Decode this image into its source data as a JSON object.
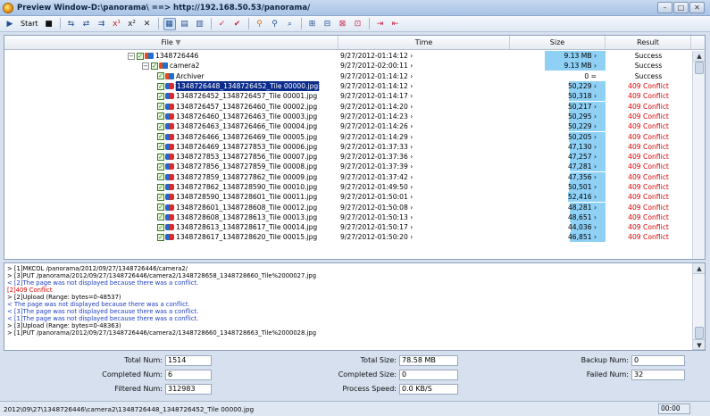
{
  "window": {
    "title": "Preview Window-D:\\panorama\\ ==> http://192.168.50.53/panorama/"
  },
  "toolbar": {
    "start_label": "Start"
  },
  "grid": {
    "columns": [
      "File",
      "Time",
      "Size",
      "Result"
    ],
    "rows": [
      {
        "indent": 0,
        "type": "root",
        "name": "1348726446",
        "time": "9/27/2012-01:14:12",
        "size": "9.13 MB",
        "result": "Success",
        "status": "ok",
        "fill": 0.45
      },
      {
        "indent": 1,
        "type": "folder",
        "name": "camera2",
        "time": "9/27/2012-02:00:11",
        "size": "9.13 MB",
        "result": "Success",
        "status": "ok",
        "fill": 0.45
      },
      {
        "indent": 2,
        "type": "folder",
        "name": "Archiver",
        "time": "9/27/2012-01:14:12",
        "size": "0",
        "result": "Success",
        "status": "ok",
        "fill": 0
      },
      {
        "indent": 2,
        "type": "file",
        "name": "1348726448_1348726452_Tile 00000.jpg",
        "time": "9/27/2012-01:14:12",
        "size": "50,229",
        "result": "409 Conflict",
        "status": "fail",
        "fill": 0.2,
        "selected": true
      },
      {
        "indent": 2,
        "type": "file",
        "name": "1348726452_1348726457_Tile 00001.jpg",
        "time": "9/27/2012-01:14:17",
        "size": "50,318",
        "result": "409 Conflict",
        "status": "fail",
        "fill": 0.2
      },
      {
        "indent": 2,
        "type": "file",
        "name": "1348726457_1348726460_Tile 00002.jpg",
        "time": "9/27/2012-01:14:20",
        "size": "50,217",
        "result": "409 Conflict",
        "status": "fail",
        "fill": 0.2
      },
      {
        "indent": 2,
        "type": "file",
        "name": "1348726460_1348726463_Tile 00003.jpg",
        "time": "9/27/2012-01:14:23",
        "size": "50,295",
        "result": "409 Conflict",
        "status": "fail",
        "fill": 0.2
      },
      {
        "indent": 2,
        "type": "file",
        "name": "1348726463_1348726466_Tile 00004.jpg",
        "time": "9/27/2012-01:14:26",
        "size": "50,229",
        "result": "409 Conflict",
        "status": "fail",
        "fill": 0.2
      },
      {
        "indent": 2,
        "type": "file",
        "name": "1348726466_1348726469_Tile 00005.jpg",
        "time": "9/27/2012-01:14:29",
        "size": "50,205",
        "result": "409 Conflict",
        "status": "fail",
        "fill": 0.2
      },
      {
        "indent": 2,
        "type": "file",
        "name": "1348726469_1348727853_Tile 00006.jpg",
        "time": "9/27/2012-01:37:33",
        "size": "47,130",
        "result": "409 Conflict",
        "status": "fail",
        "fill": 0.19
      },
      {
        "indent": 2,
        "type": "file",
        "name": "1348727853_1348727856_Tile 00007.jpg",
        "time": "9/27/2012-01:37:36",
        "size": "47,257",
        "result": "409 Conflict",
        "status": "fail",
        "fill": 0.19
      },
      {
        "indent": 2,
        "type": "file",
        "name": "1348727856_1348727859_Tile 00008.jpg",
        "time": "9/27/2012-01:37:39",
        "size": "47,281",
        "result": "409 Conflict",
        "status": "fail",
        "fill": 0.19
      },
      {
        "indent": 2,
        "type": "file",
        "name": "1348727859_1348727862_Tile 00009.jpg",
        "time": "9/27/2012-01:37:42",
        "size": "47,356",
        "result": "409 Conflict",
        "status": "fail",
        "fill": 0.19
      },
      {
        "indent": 2,
        "type": "file",
        "name": "1348727862_1348728590_Tile 00010.jpg",
        "time": "9/27/2012-01:49:50",
        "size": "50,501",
        "result": "409 Conflict",
        "status": "fail",
        "fill": 0.2
      },
      {
        "indent": 2,
        "type": "file",
        "name": "1348728590_1348728601_Tile 00011.jpg",
        "time": "9/27/2012-01:50:01",
        "size": "52,416",
        "result": "409 Conflict",
        "status": "fail",
        "fill": 0.21
      },
      {
        "indent": 2,
        "type": "file",
        "name": "1348728601_1348728608_Tile 00012.jpg",
        "time": "9/27/2012-01:50:08",
        "size": "48,281",
        "result": "409 Conflict",
        "status": "fail",
        "fill": 0.19
      },
      {
        "indent": 2,
        "type": "file",
        "name": "1348728608_1348728613_Tile 00013.jpg",
        "time": "9/27/2012-01:50:13",
        "size": "48,651",
        "result": "409 Conflict",
        "status": "fail",
        "fill": 0.19
      },
      {
        "indent": 2,
        "type": "file",
        "name": "1348728613_1348728617_Tile 00014.jpg",
        "time": "9/27/2012-01:50:17",
        "size": "44,036",
        "result": "409 Conflict",
        "status": "fail",
        "fill": 0.18
      },
      {
        "indent": 2,
        "type": "file",
        "name": "1348728617_1348728620_Tile 00015.jpg",
        "time": "9/27/2012-01:50:20",
        "size": "46,851",
        "result": "409 Conflict",
        "status": "fail",
        "fill": 0.19
      }
    ]
  },
  "log": {
    "lines": [
      {
        "color": "black",
        "text": "> [1]MKCOL /panorama/2012/09/27/1348726446/camera2/"
      },
      {
        "color": "black",
        "text": "> [3]PUT /panorama/2012/09/27/1348726446/camera2/1348728658_1348728660_Tile%2000027.jpg"
      },
      {
        "color": "blue",
        "text": "< [2]The page was not displayed because there was a conflict."
      },
      {
        "color": "red",
        "text": "      [2]409 Conflict"
      },
      {
        "color": "black",
        "text": "> [2]Upload (Range: bytes=0-48537)"
      },
      {
        "color": "blue",
        "text": "< The page was not displayed because there was a conflict."
      },
      {
        "color": "blue",
        "text": "< [3]The page was not displayed because there was a conflict."
      },
      {
        "color": "blue",
        "text": "< [1]The page was not displayed because there was a conflict."
      },
      {
        "color": "black",
        "text": "> [3]Upload (Range: bytes=0-48363)"
      },
      {
        "color": "black",
        "text": "> [1]PUT /panorama/2012/09/27/1348726446/camera2/1348728660_1348728663_Tile%2000028.jpg"
      }
    ]
  },
  "stats": {
    "total_num_label": "Total Num:",
    "total_num": "1514",
    "completed_num_label": "Completed Num:",
    "completed_num": "6",
    "filtered_num_label": "Filtered Num:",
    "filtered_num": "312983",
    "total_size_label": "Total Size:",
    "total_size": "78.58 MB",
    "completed_size_label": "Completed Size:",
    "completed_size": "0",
    "process_speed_label": "Process Speed:",
    "process_speed": "0.0 KB/S",
    "backup_num_label": "Backup Num:",
    "backup_num": "0",
    "failed_num_label": "Failed Num:",
    "failed_num": "32"
  },
  "statusbar": {
    "path": "2012\\09\\27\\1348726446\\camera2\\1348726448_1348726452_Tile 00000.jpg",
    "time": "00:00"
  },
  "colors": {
    "accent": "#0a2c8c",
    "size_bar": "#8fd0f5",
    "error": "#e00000",
    "log_blue": "#1d3fc2"
  }
}
